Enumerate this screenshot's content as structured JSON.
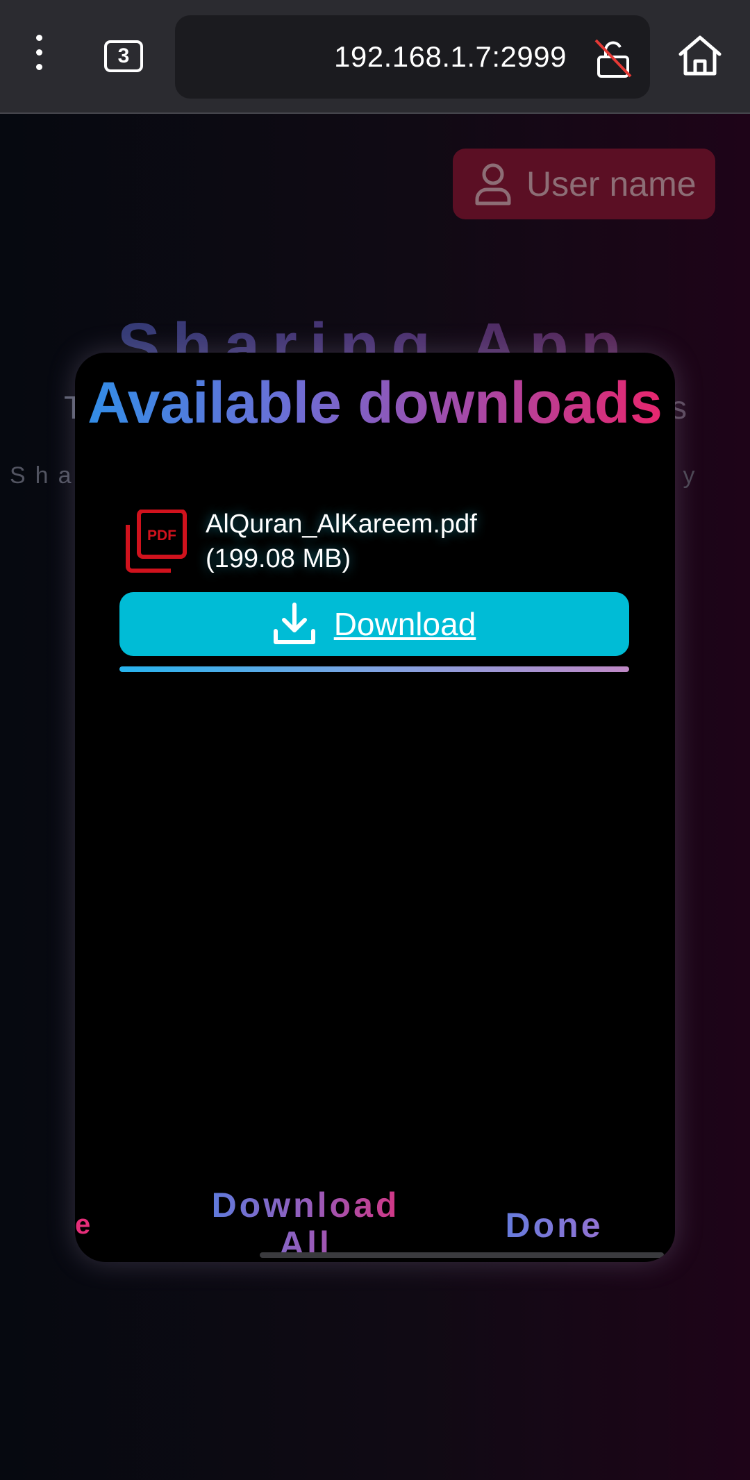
{
  "browser": {
    "tab_count": "3",
    "url": "192.168.1.7:2999",
    "icons": [
      "more-vert-icon",
      "tabs-icon",
      "insecure-lock-icon",
      "home-icon"
    ]
  },
  "background_page": {
    "user_chip_label": "User name",
    "title": "Sharing App",
    "subtitle_left": "Sha",
    "subtitle_right": "way",
    "line_left": "T",
    "line_right": "s"
  },
  "modal": {
    "title": "Available downloads",
    "file": {
      "name": "AlQuran_AlKareem.pdf",
      "size": "(199.08 MB)",
      "icon": "pdf-file-icon"
    },
    "download_button_label": "Download",
    "download_progress": 1.0,
    "partial_left_label": "e",
    "download_all_line1": "Download",
    "download_all_line2": "All",
    "done_label": "Done"
  },
  "colors": {
    "chrome_bg": "#2b2b30",
    "download_button": "#00bcd6",
    "title_gradient_start": "#2f8fe8",
    "title_gradient_end": "#ec246a",
    "pdf_icon": "#d0121d",
    "user_chip_bg": "#5b0f24"
  }
}
